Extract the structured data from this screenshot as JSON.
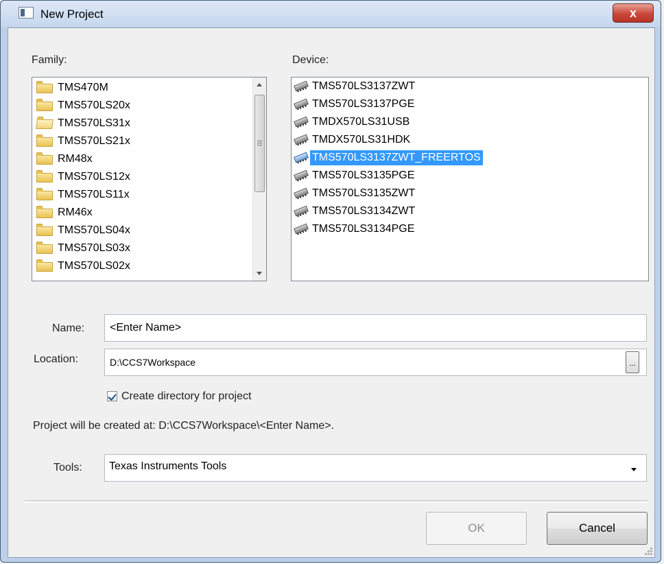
{
  "window": {
    "title": "New Project",
    "close_symbol": "x"
  },
  "family": {
    "label": "Family:",
    "items": [
      "TMS470M",
      "TMS570LS20x",
      "TMS570LS31x",
      "TMS570LS21x",
      "RM48x",
      "TMS570LS12x",
      "TMS570LS11x",
      "RM46x",
      "TMS570LS04x",
      "TMS570LS03x",
      "TMS570LS02x"
    ],
    "selected_index": 2
  },
  "device": {
    "label": "Device:",
    "items": [
      "TMS570LS3137ZWT",
      "TMS570LS3137PGE",
      "TMDX570LS31USB",
      "TMDX570LS31HDK",
      "TMS570LS3137ZWT_FREERTOS",
      "TMS570LS3135PGE",
      "TMS570LS3135ZWT",
      "TMS570LS3134ZWT",
      "TMS570LS3134PGE"
    ],
    "selected_index": 4
  },
  "form": {
    "name_label": "Name:",
    "name_value": "<Enter Name>",
    "location_label": "Location:",
    "location_value": "D:\\CCS7Workspace",
    "browse_label": "...",
    "create_dir_label": "Create directory for project",
    "create_dir_checked": true,
    "project_path_text": "Project will be created at: D:\\CCS7Workspace\\<Enter Name>.",
    "tools_label": "Tools:",
    "tools_value": "Texas Instruments Tools"
  },
  "buttons": {
    "ok": "OK",
    "cancel": "Cancel"
  },
  "icons": {
    "folder": "folder-icon",
    "device": "chip-icon",
    "close": "close-icon"
  },
  "colors": {
    "selection": "#3399ff",
    "close_button": "#c9473a"
  }
}
